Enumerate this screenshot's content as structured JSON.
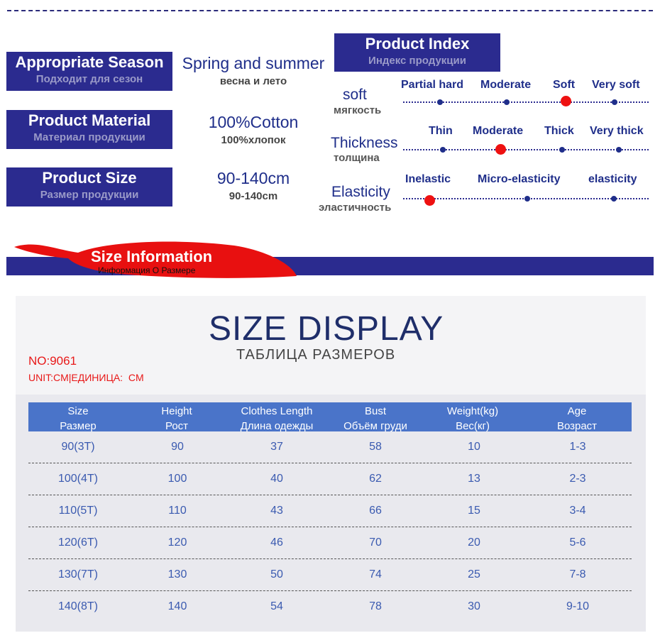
{
  "info": [
    {
      "label_en": "Appropriate Season",
      "label_ru": "Подходит для сезон",
      "value_en": "Spring and summer",
      "value_ru": "весна и лето"
    },
    {
      "label_en": "Product Material",
      "label_ru": "Материал продукции",
      "value_en": "100%Cotton",
      "value_ru": "100%хлопок"
    },
    {
      "label_en": "Product Size",
      "label_ru": "Размер продукции",
      "value_en": "90-140cm",
      "value_ru": "90-140cm"
    }
  ],
  "product_index": {
    "title_en": "Product Index",
    "title_ru": "Индекс продукции",
    "rows": [
      {
        "name_en": "soft",
        "name_ru": "мягкость",
        "options": [
          "Partial hard",
          "Moderate",
          "Soft",
          "Very soft"
        ],
        "selected": 2
      },
      {
        "name_en": "Thickness",
        "name_ru": "толщина",
        "options": [
          "Thin",
          "Moderate",
          "Thick",
          "Very thick"
        ],
        "selected": 1
      },
      {
        "name_en": "Elasticity",
        "name_ru": "эластичность",
        "options": [
          "Inelastic",
          "Micro-elasticity",
          "elasticity"
        ],
        "selected": 0
      }
    ]
  },
  "size_info": {
    "title_en": "Size Information",
    "title_ru": "Информация О Размере"
  },
  "size_display": {
    "title": "SIZE DISPLAY",
    "subtitle": "ТАБЛИЦА РАЗМЕРОВ",
    "model_no": "NO:9061",
    "unit": "UNIT:CM|ЕДИНИЦА:  CM"
  },
  "table": {
    "headers": [
      {
        "en": "Size",
        "ru": "Размер"
      },
      {
        "en": "Height",
        "ru": "Рост"
      },
      {
        "en": "Clothes Length",
        "ru": "Длина одежды"
      },
      {
        "en": "Bust",
        "ru": "Объём груди"
      },
      {
        "en": "Weight(kg)",
        "ru": "Вес(кг)"
      },
      {
        "en": "Age",
        "ru": "Возраст"
      }
    ],
    "rows": [
      [
        "90(3T)",
        "90",
        "37",
        "58",
        "10",
        "1-3"
      ],
      [
        "100(4T)",
        "100",
        "40",
        "62",
        "13",
        "2-3"
      ],
      [
        "110(5T)",
        "110",
        "43",
        "66",
        "15",
        "3-4"
      ],
      [
        "120(6T)",
        "120",
        "46",
        "70",
        "20",
        "5-6"
      ],
      [
        "130(7T)",
        "130",
        "50",
        "74",
        "25",
        "7-8"
      ],
      [
        "140(8T)",
        "140",
        "54",
        "78",
        "30",
        "9-10"
      ]
    ]
  },
  "colors": {
    "navy": "#2b2b8f",
    "accent_red": "#e81818",
    "table_header": "#4a74c9"
  }
}
